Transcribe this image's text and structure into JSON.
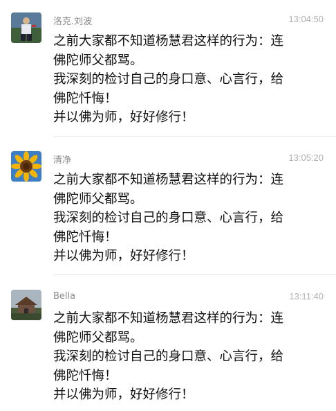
{
  "messages": [
    {
      "sender": "洛克.刘波",
      "time": "13:04:50",
      "lines": [
        "之前大家都不知道杨慧君这样的行为：连",
        "佛陀师父都骂。",
        "我深刻的检讨自己的身口意、心言行，给",
        "佛陀忏悔！",
        "并以佛为师，好好修行！"
      ],
      "avatar_icon": "sports-photo-avatar"
    },
    {
      "sender": "清净",
      "time": "13:05:20",
      "lines": [
        "之前大家都不知道杨慧君这样的行为：连",
        "佛陀师父都骂。",
        "我深刻的检讨自己的身口意、心言行，给",
        "佛陀忏悔！",
        "并以佛为师，好好修行！"
      ],
      "avatar_icon": "sunflower-avatar"
    },
    {
      "sender": "Bella",
      "time": "13:11:40",
      "lines": [
        "之前大家都不知道杨慧君这样的行为：连",
        "佛陀师父都骂。",
        "我深刻的检讨自己的身口意、心言行，给",
        "佛陀忏悔！",
        "并以佛为师，好好修行！"
      ],
      "avatar_icon": "house-photo-avatar"
    }
  ]
}
